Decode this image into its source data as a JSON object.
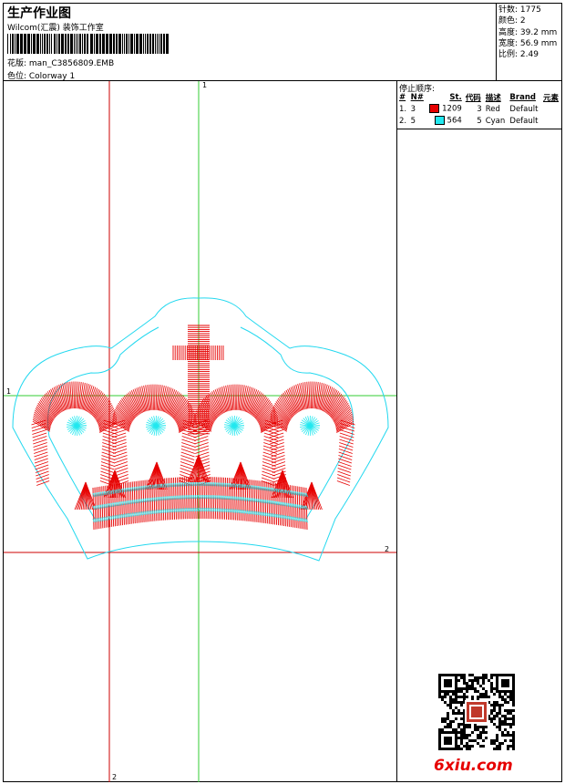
{
  "header": {
    "title": "生产作业图",
    "company": "Wilcom(汇震) 装饰工作室",
    "design_file": "花版: man_C3856809.EMB",
    "colorway": "色位: Colorway 1"
  },
  "stats": {
    "stitches": "针数: 1775",
    "colors": "颜色: 2",
    "height": "高度: 39.2 mm",
    "width": "宽度: 56.9 mm",
    "ratio": "比例: 2.49"
  },
  "stop_sequence": {
    "title": "停止顺序:",
    "headers": [
      "#",
      "N#",
      "St.",
      "代码",
      "描述",
      "Brand",
      "元素"
    ],
    "rows": [
      {
        "index": "1.",
        "needle": "3",
        "color": "#e60000",
        "stitches": "1209",
        "code": "3",
        "description": "Red",
        "brand": "Default"
      },
      {
        "index": "2.",
        "needle": "5",
        "color": "#22e8ef",
        "stitches": "564",
        "code": "5",
        "description": "Cyan",
        "brand": "Default"
      }
    ]
  },
  "markers": {
    "top": "1",
    "left": "1",
    "right": "2",
    "bottom": "2"
  },
  "watermark": "6xiu.com",
  "colors": {
    "thread_red": "#e60000",
    "thread_cyan": "#22e8ef",
    "guide_green": "#33cc33",
    "guide_red": "#cc0000",
    "outline": "#22d8ef"
  },
  "icons": [
    "barcode-icon",
    "qr-code-icon"
  ]
}
